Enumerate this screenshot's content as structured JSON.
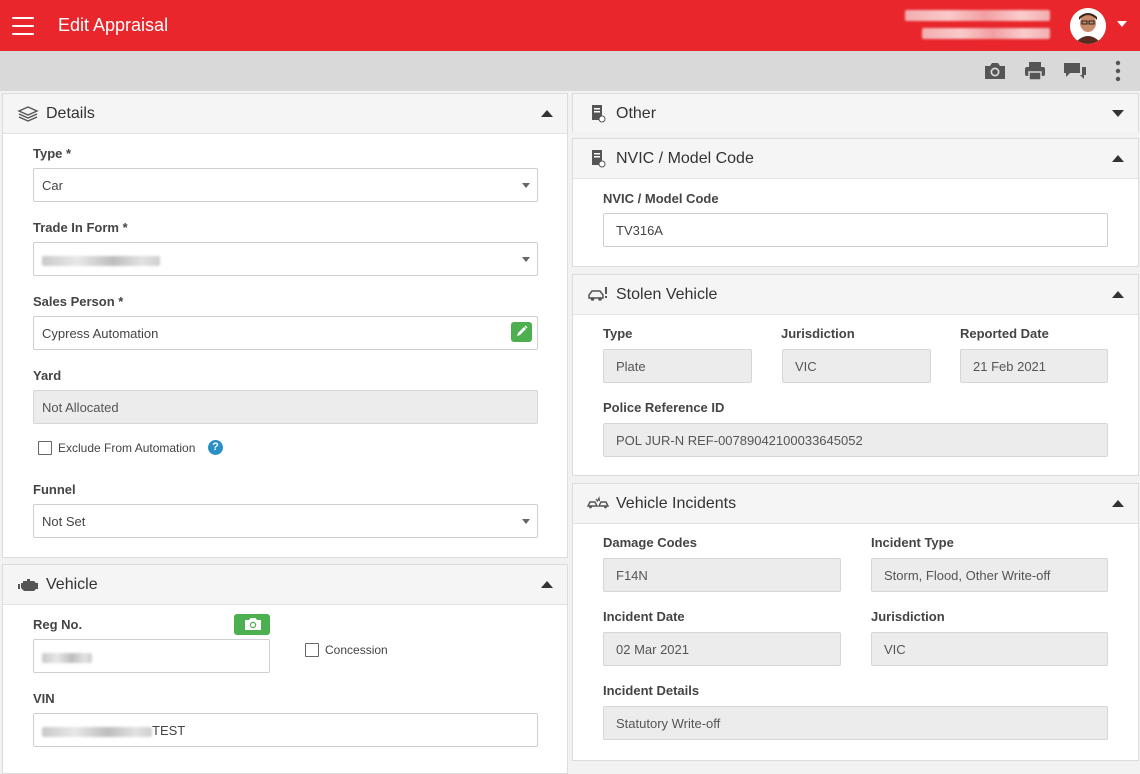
{
  "header": {
    "title": "Edit Appraisal"
  },
  "details": {
    "title": "Details",
    "type_label": "Type *",
    "type_value": "Car",
    "trade_in_label": "Trade In Form *",
    "sales_person_label": "Sales Person *",
    "sales_person_value": "Cypress Automation",
    "yard_label": "Yard",
    "yard_value": "Not Allocated",
    "exclude_label": "Exclude From Automation",
    "help_glyph": "?",
    "funnel_label": "Funnel",
    "funnel_value": "Not Set"
  },
  "vehicle": {
    "title": "Vehicle",
    "reg_label": "Reg No.",
    "concession_label": "Concession",
    "vin_label": "VIN",
    "vin_suffix": "TEST"
  },
  "other": {
    "title": "Other"
  },
  "nvic": {
    "title": "NVIC / Model Code",
    "label": "NVIC / Model Code",
    "value": "TV316A"
  },
  "stolen": {
    "title": "Stolen Vehicle",
    "type_label": "Type",
    "type_value": "Plate",
    "jurisdiction_label": "Jurisdiction",
    "jurisdiction_value": "VIC",
    "reported_label": "Reported Date",
    "reported_value": "21 Feb 2021",
    "police_ref_label": "Police Reference ID",
    "police_ref_value": "POL JUR-N REF-00789042100033645052"
  },
  "incidents": {
    "title": "Vehicle Incidents",
    "damage_label": "Damage Codes",
    "damage_value": "F14N",
    "incident_type_label": "Incident Type",
    "incident_type_value": "Storm, Flood, Other Write-off",
    "incident_date_label": "Incident Date",
    "incident_date_value": "02 Mar 2021",
    "jurisdiction_label": "Jurisdiction",
    "jurisdiction_value": "VIC",
    "details_label": "Incident Details",
    "details_value": "Statutory Write-off"
  },
  "colors": {
    "brand_red": "#e8262b",
    "toolbar_gray": "#d9d9d9",
    "action_green": "#4caf50",
    "help_blue": "#2a8fc4"
  },
  "icons": {
    "menu": "hamburger-icon",
    "camera": "camera-icon",
    "print": "printer-icon",
    "chat": "chat-icon",
    "more": "more-vertical-icon",
    "details": "layers-icon",
    "vehicle": "engine-icon",
    "other": "document-icon",
    "stolen": "stolen-car-icon",
    "incidents": "car-crash-icon",
    "edit": "pencil-icon"
  }
}
